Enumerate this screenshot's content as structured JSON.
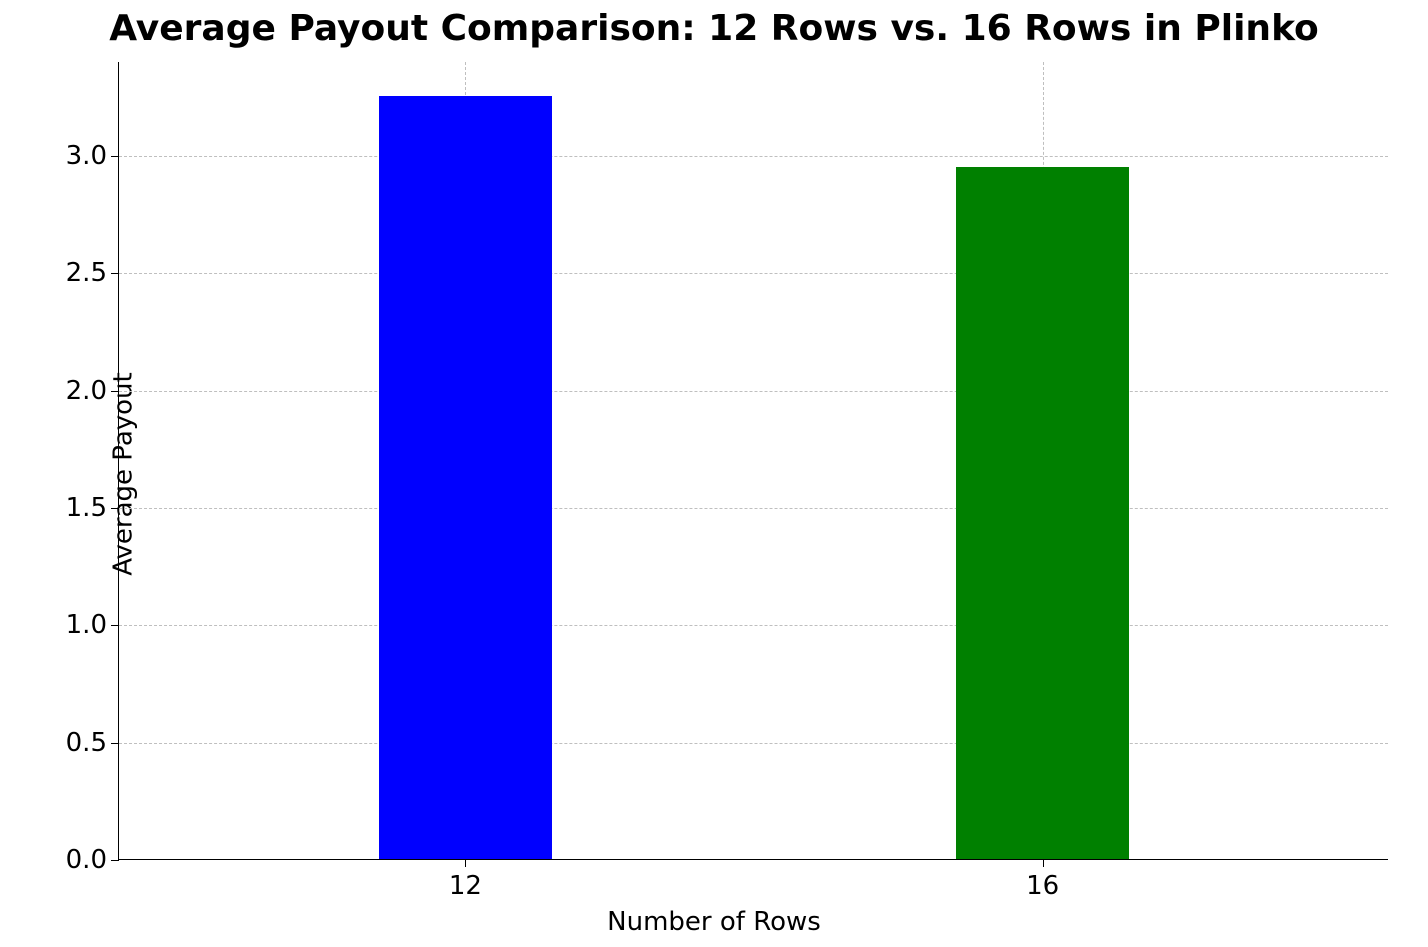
{
  "chart_data": {
    "type": "bar",
    "title": "Average Payout Comparison: 12 Rows vs. 16 Rows in Plinko",
    "xlabel": "Number of Rows",
    "ylabel": "Average Payout",
    "categories": [
      "12",
      "16"
    ],
    "values": [
      3.25,
      2.95
    ],
    "colors": [
      "#0000FF",
      "#008000"
    ],
    "ylim": [
      0,
      3.4
    ],
    "y_ticks": [
      0.0,
      0.5,
      1.0,
      1.5,
      2.0,
      2.5,
      3.0
    ],
    "y_tick_labels": [
      "0.0",
      "0.5",
      "1.0",
      "1.5",
      "2.0",
      "2.5",
      "3.0"
    ]
  }
}
